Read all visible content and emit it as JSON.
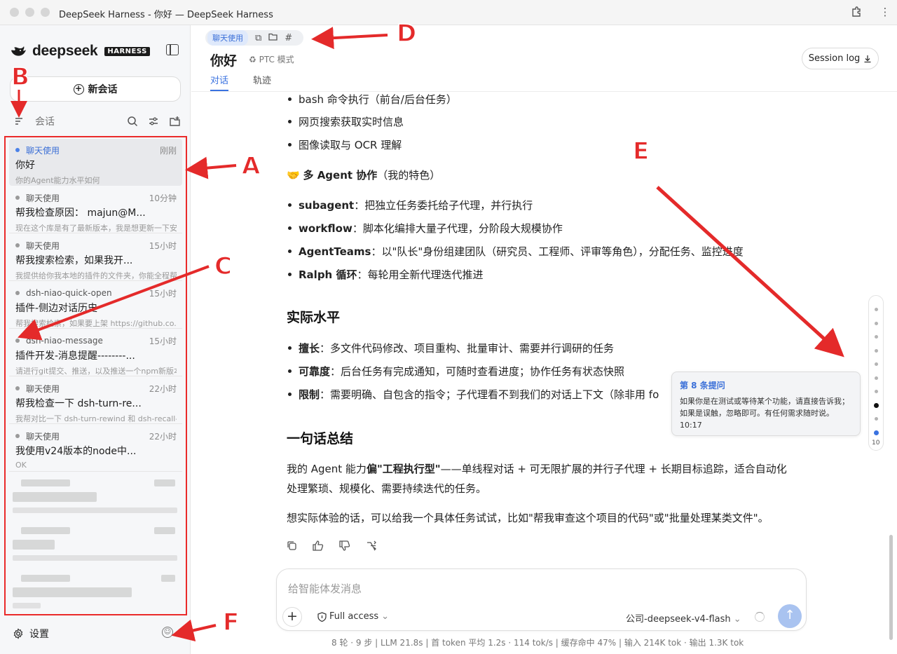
{
  "window": {
    "title": "DeepSeek Harness - 你好 — DeepSeek Harness"
  },
  "sidebar": {
    "logo_text": "deepseek",
    "logo_badge": "HARNESS",
    "new_chat_label": "新会话",
    "conversations_label": "会话",
    "items": [
      {
        "tag": "聊天使用",
        "time": "刚刚",
        "title": "你好",
        "preview": "你的Agent能力水平如何"
      },
      {
        "tag": "聊天使用",
        "time": "10分钟",
        "title": "帮我检查原因： majun@M...",
        "preview": "现在这个库是有了最新版本，我是想更新一下安..."
      },
      {
        "tag": "聊天使用",
        "time": "15小时",
        "title": "帮我搜索检索，如果我开...",
        "preview": "我提供给你我本地的插件的文件夹，你能全程帮..."
      },
      {
        "tag": "dsh-niao-quick-open",
        "time": "15小时",
        "title": "插件-侧边对话历史",
        "preview": "帮我搜索检索，如果要上架 https://github.co..."
      },
      {
        "tag": "dsh-niao-message",
        "time": "15小时",
        "title": "插件开发-消息提醒--------...",
        "preview": "请进行git提交、推送，以及推送一个npm新版本"
      },
      {
        "tag": "聊天使用",
        "time": "22小时",
        "title": "帮我检查一下 dsh-turn-re...",
        "preview": "我帮对比一下 dsh-turn-rewind 和 dsh-recall-..."
      },
      {
        "tag": "聊天使用",
        "time": "22小时",
        "title": "我使用v24版本的node中...",
        "preview": "OK"
      }
    ],
    "settings_label": "设置"
  },
  "header": {
    "tag": "聊天使用",
    "title": "你好",
    "mode": "PTC 模式",
    "session_log": "Session log",
    "tabs": [
      "对话",
      "轨迹"
    ]
  },
  "content": {
    "bullets_top": [
      "bash 命令执行（前台/后台任务）",
      "网页搜索获取实时信息",
      "图像读取与 OCR 理解"
    ],
    "multi_agent_title": "多 Agent 协作",
    "multi_agent_suffix": "（我的特色）",
    "multi_agent_items": [
      {
        "name": "subagent",
        "desc": "：把独立任务委托给子代理，并行执行"
      },
      {
        "name": "workflow",
        "desc": "：脚本化编排大量子代理，分阶段大规模协作"
      },
      {
        "name": "AgentTeams",
        "desc": "：以\"队长\"身份组建团队（研究员、工程师、评审等角色），分配任务、监控进度"
      },
      {
        "name": "Ralph 循环",
        "desc": "：每轮用全新代理迭代推进"
      }
    ],
    "level_heading": "实际水平",
    "level_items": [
      {
        "name": "擅长",
        "desc": "：多文件代码修改、项目重构、批量审计、需要并行调研的任务"
      },
      {
        "name": "可靠度",
        "desc": "：后台任务有完成通知，可随时查看进度；协作任务有状态快照"
      },
      {
        "name": "限制",
        "desc": "：需要明确、自包含的指令；子代理看不到我们的对话上下文（除非用 fo"
      }
    ],
    "summary_heading": "一句话总结",
    "summary_p1_a": "我的 Agent 能力",
    "summary_p1_b": "偏\"工程执行型\"",
    "summary_p1_c": "——单线程对话 + 可无限扩展的并行子代理 + 长期目标追踪，适合自动化",
    "summary_p1_d": "处理繁琐、规模化、需要持续迭代的任务。",
    "summary_p2": "想实际体验的话，可以给我一个具体任务试试，比如\"帮我审查这个项目的代码\"或\"批量处理某类文件\"。"
  },
  "tooltip": {
    "title": "第 8 条提问",
    "body": "如果你是在测试或等待某个功能，请直接告诉我；如果是误触，忽略即可。有任何需求随时说。10:17"
  },
  "scroll_index": {
    "count_label": "10",
    "active_dark": 8,
    "active_blue": 10
  },
  "composer": {
    "placeholder": "给智能体发消息",
    "access": "Full access",
    "model": "公司-deepseek-v4-flash"
  },
  "stats": "8 轮 · 9 步   |   LLM 21.8s   |   首 token 平均 1.2s · 114 tok/s   |   缓存命中 47%   |   输入 214K tok · 输出 1.3K tok",
  "annotations": [
    "A",
    "B",
    "C",
    "D",
    "E",
    "F"
  ],
  "colors": {
    "accent": "#3a72e0",
    "annotation": "#e42a2a",
    "tag_bg": "#dfe9fb"
  }
}
